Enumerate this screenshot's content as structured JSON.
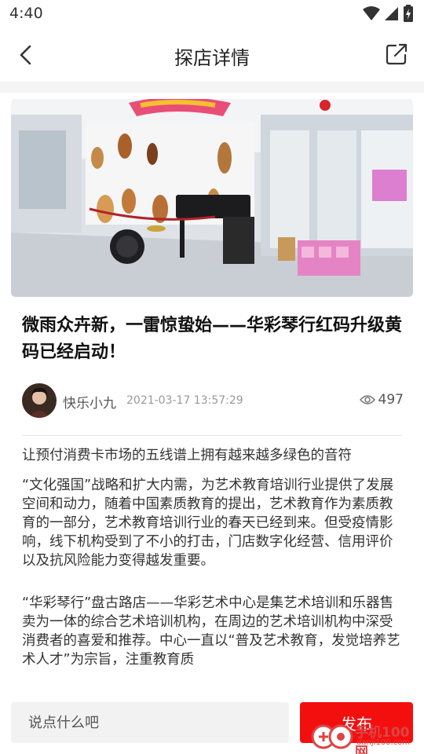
{
  "status_bar": {
    "time": "4:40"
  },
  "header": {
    "title": "探店详情"
  },
  "article": {
    "title": "微雨众卉新，一雷惊蛰始——华彩琴行红码升级黄码已经启动！",
    "author": "快乐小九",
    "date": "2021-03-17 13:57:29",
    "views": "497",
    "paragraphs": [
      "让预付消费卡市场的五线谱上拥有越来越多绿色的音符",
      "“文化强国”战略和扩大内需，为艺术教育培训行业提供了发展空间和动力，随着中国素质教育的提出，艺术教育作为素质教育的一部分，艺术教育培训行业的春天已经到来。但受疫情影响，线下机构受到了不小的打击，门店数字化经营、信用评价以及抗风险能力变得越发重要。",
      " “华彩琴行”盘古路店——华彩艺术中心是集艺术培训和乐器售卖为一体的综合艺术培训机构，在周边的艺术培训机构中深受消费者的喜爱和推荐。中心一直以“普及艺术教育，发觉培养艺术人才”为宗旨，注重教育质"
    ]
  },
  "comment_bar": {
    "placeholder": "说点什么吧",
    "publish_label": "发布"
  },
  "watermark": {
    "name": "手机100网",
    "url": "danji100.com"
  },
  "colors": {
    "accent": "#f40f0f"
  }
}
